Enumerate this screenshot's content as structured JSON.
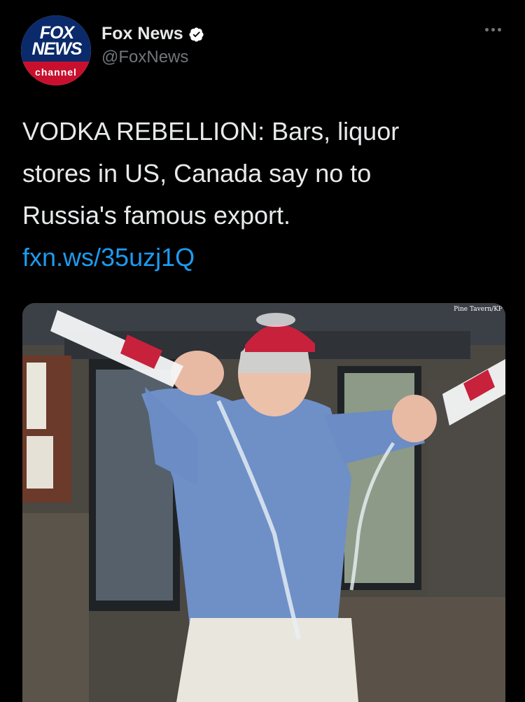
{
  "account": {
    "display_name": "Fox News",
    "handle": "@FoxNews",
    "verified": true,
    "avatar": {
      "logo_text_line1": "FOX",
      "logo_text_line2": "NEWS",
      "logo_sub": "channel"
    }
  },
  "menu": {
    "icon": "more-horizontal-icon"
  },
  "tweet": {
    "text": "VODKA REBELLION: Bars, liquor stores in US, Canada say no to Russia's famous export.",
    "link_text": "fxn.ws/35uzj1Q"
  },
  "media": {
    "credit": "Pine Tavern/KP"
  },
  "colors": {
    "background": "#000000",
    "text": "#e7e9ea",
    "secondary_text": "#71767b",
    "link": "#1d9bf0",
    "verified_badge": "#ffffff"
  }
}
